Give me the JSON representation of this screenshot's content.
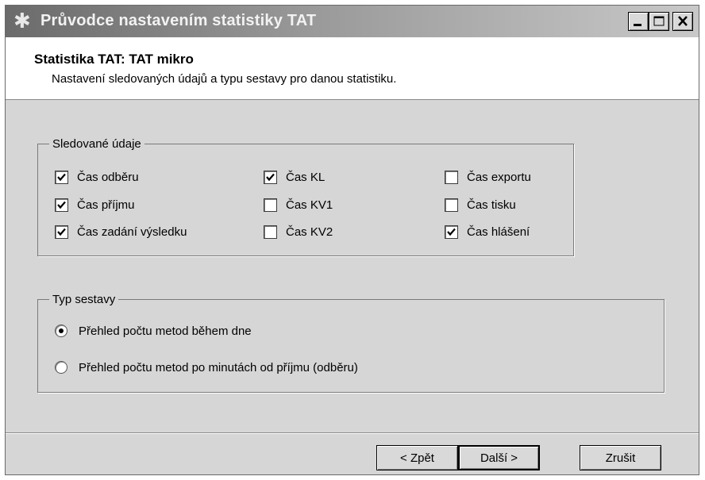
{
  "window": {
    "title": "Průvodce nastavením statistiky TAT",
    "icon": "wizard-star-icon"
  },
  "header": {
    "title": "Statistika TAT: TAT mikro",
    "subtitle": "Nastavení sledovaných údajů a typu sestavy pro danou statistiku."
  },
  "tracked": {
    "legend": "Sledované údaje",
    "items": [
      {
        "label": "Čas odběru",
        "checked": true
      },
      {
        "label": "Čas příjmu",
        "checked": true
      },
      {
        "label": "Čas zadání výsledku",
        "checked": true
      },
      {
        "label": "Čas KL",
        "checked": true
      },
      {
        "label": "Čas KV1",
        "checked": false
      },
      {
        "label": "Čas KV2",
        "checked": false
      },
      {
        "label": "Čas exportu",
        "checked": false
      },
      {
        "label": "Čas tisku",
        "checked": false
      },
      {
        "label": "Čas hlášení",
        "checked": true
      }
    ]
  },
  "report": {
    "legend": "Typ sestavy",
    "options": [
      {
        "label": "Přehled počtu metod během dne",
        "selected": true
      },
      {
        "label": "Přehled počtu metod po minutách od příjmu (odběru)",
        "selected": false
      }
    ]
  },
  "buttons": {
    "back": "< Zpět",
    "next": "Další >",
    "cancel": "Zrušit"
  }
}
